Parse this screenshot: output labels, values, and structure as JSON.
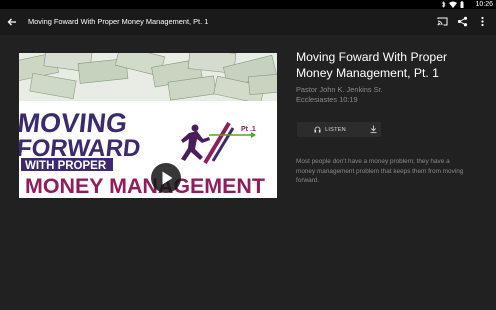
{
  "status_bar": {
    "time": "10:26",
    "icons": [
      "bluetooth-icon",
      "wifi-icon",
      "battery-icon"
    ]
  },
  "toolbar": {
    "title": "Moving Foward With Proper Money Management, Pt. 1",
    "icons": [
      "back-arrow-icon",
      "cast-icon",
      "share-icon",
      "more-vert-icon"
    ]
  },
  "artwork": {
    "line1": "MOVING",
    "line2": "FORWARD",
    "line3": "WITH PROPER",
    "line4": "MONEY MANAGEMENT",
    "badge": "Pt .1"
  },
  "episode": {
    "title": "Moving Foward With Proper Money Management, Pt. 1",
    "speaker": "Pastor John K. Jenkins Sr.",
    "scripture": "Ecclesiastes 10:19",
    "listen_label": "LISTEN",
    "description": "Most people don't have a money problem; they have a money management problem that keeps them from moving forward."
  },
  "colors": {
    "background": "#212121",
    "toolbar": "#1a1a1a",
    "art_purple": "#3b2a6e",
    "art_magenta": "#8e1e5a",
    "art_green": "#5aa02c"
  }
}
